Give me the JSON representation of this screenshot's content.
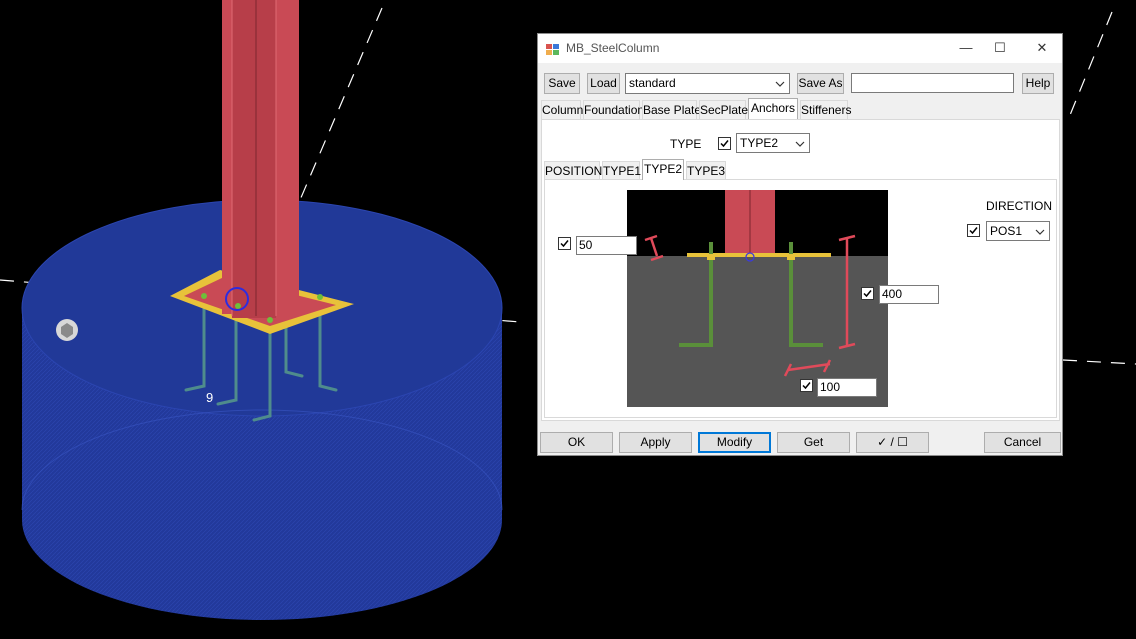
{
  "viewport": {
    "marker_label": "9",
    "colors": {
      "background": "#000000",
      "foundation": "#22399b",
      "column": "#c94a55",
      "base_plate": "#e8c23a",
      "anchor": "#4f8c8c"
    }
  },
  "dialog": {
    "title": "MB_SteelColumn",
    "controls": {
      "minimize": "—",
      "maximize": "☐",
      "close": "✕"
    },
    "toolbar": {
      "save": "Save",
      "load": "Load",
      "preset": "standard",
      "save_as": "Save As",
      "save_as_name": "",
      "help": "Help"
    },
    "tabs": [
      "Column",
      "Foundation",
      "Base Plate",
      "SecPlate",
      "Anchors",
      "Stiffeners"
    ],
    "active_tab": "Anchors",
    "anchors": {
      "type_label": "TYPE",
      "type_value": "TYPE2",
      "subtabs": [
        "POSITION",
        "TYPE1",
        "TYPE2",
        "TYPE3"
      ],
      "active_subtab": "TYPE2",
      "direction_label": "DIRECTION",
      "direction_value": "POS1",
      "dim_top": "50",
      "dim_length": "400",
      "dim_hook": "100"
    },
    "footer": {
      "ok": "OK",
      "apply": "Apply",
      "modify": "Modify",
      "get": "Get",
      "toggle": "✓ / ☐",
      "cancel": "Cancel"
    }
  }
}
